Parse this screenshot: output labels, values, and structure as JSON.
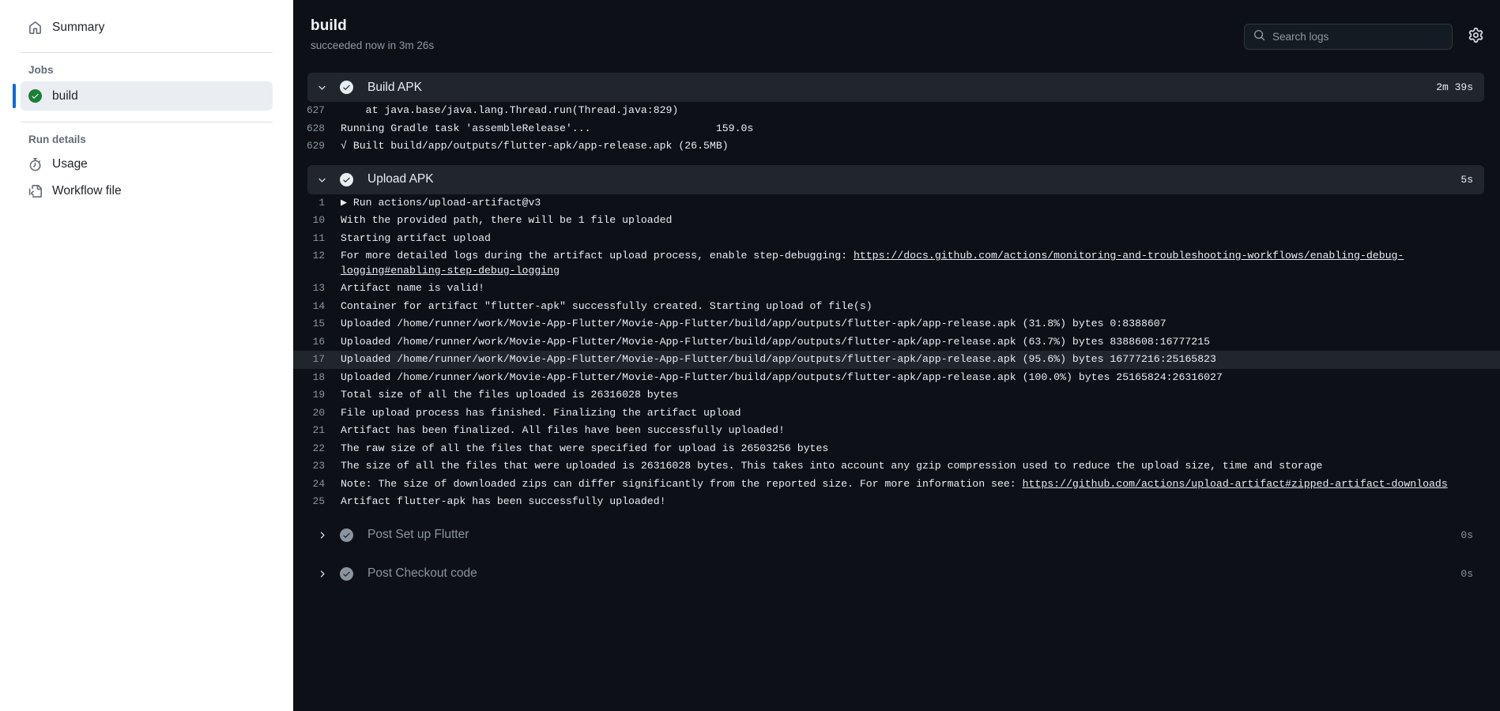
{
  "sidebar": {
    "summary": {
      "label": "Summary",
      "icon": "home-icon"
    },
    "jobs_group_label": "Jobs",
    "job": {
      "label": "build",
      "status": "success"
    },
    "run_details_group_label": "Run details",
    "usage": {
      "label": "Usage",
      "icon": "stopwatch-icon"
    },
    "workflow_file": {
      "label": "Workflow file",
      "icon": "file-code-icon"
    }
  },
  "header": {
    "title": "build",
    "subtitle": "succeeded now in 3m 26s",
    "search_placeholder": "Search logs",
    "search_value": "",
    "gear_label": "gear-icon"
  },
  "colors": {
    "accent_blue": "#0969da",
    "success_green": "#1a7f37",
    "panel_bg": "#0d1117",
    "step_bg": "#21262d",
    "text": "#e6edf3",
    "muted": "#8b949e"
  },
  "steps": [
    {
      "name": "Build APK",
      "duration": "2m 39s",
      "expanded": true,
      "status": "success",
      "lines": [
        {
          "no": "627",
          "text": "    at java.base/java.lang.Thread.run(Thread.java:829)"
        },
        {
          "no": "628",
          "text": "Running Gradle task 'assembleRelease'...                    159.0s"
        },
        {
          "no": "629",
          "text": "√ Built build/app/outputs/flutter-apk/app-release.apk (26.5MB)"
        }
      ]
    },
    {
      "name": "Upload APK",
      "duration": "5s",
      "expanded": true,
      "status": "success",
      "lines": [
        {
          "no": "1",
          "text": "▶ Run actions/upload-artifact@v3"
        },
        {
          "no": "10",
          "text": "With the provided path, there will be 1 file uploaded"
        },
        {
          "no": "11",
          "text": "Starting artifact upload"
        },
        {
          "no": "12",
          "text": "For more detailed logs during the artifact upload process, enable step-debugging: ",
          "link": "https://docs.github.com/actions/monitoring-and-troubleshooting-workflows/enabling-debug-logging#enabling-step-debug-logging"
        },
        {
          "no": "13",
          "text": "Artifact name is valid!"
        },
        {
          "no": "14",
          "text": "Container for artifact \"flutter-apk\" successfully created. Starting upload of file(s)"
        },
        {
          "no": "15",
          "text": "Uploaded /home/runner/work/Movie-App-Flutter/Movie-App-Flutter/build/app/outputs/flutter-apk/app-release.apk (31.8%) bytes 0:8388607"
        },
        {
          "no": "16",
          "text": "Uploaded /home/runner/work/Movie-App-Flutter/Movie-App-Flutter/build/app/outputs/flutter-apk/app-release.apk (63.7%) bytes 8388608:16777215"
        },
        {
          "no": "17",
          "text": "Uploaded /home/runner/work/Movie-App-Flutter/Movie-App-Flutter/build/app/outputs/flutter-apk/app-release.apk (95.6%) bytes 16777216:25165823",
          "highlighted": true
        },
        {
          "no": "18",
          "text": "Uploaded /home/runner/work/Movie-App-Flutter/Movie-App-Flutter/build/app/outputs/flutter-apk/app-release.apk (100.0%) bytes 25165824:26316027"
        },
        {
          "no": "19",
          "text": "Total size of all the files uploaded is 26316028 bytes"
        },
        {
          "no": "20",
          "text": "File upload process has finished. Finalizing the artifact upload"
        },
        {
          "no": "21",
          "text": "Artifact has been finalized. All files have been successfully uploaded!"
        },
        {
          "no": "22",
          "text": "The raw size of all the files that were specified for upload is 26503256 bytes"
        },
        {
          "no": "23",
          "text": "The size of all the files that were uploaded is 26316028 bytes. This takes into account any gzip compression used to reduce the upload size, time and storage"
        },
        {
          "no": "24",
          "text": "Note: The size of downloaded zips can differ significantly from the reported size. For more information see: ",
          "link": "https://github.com/actions/upload-artifact#zipped-artifact-downloads"
        },
        {
          "no": "25",
          "text": "Artifact flutter-apk has been successfully uploaded!"
        }
      ]
    },
    {
      "name": "Post Set up Flutter",
      "duration": "0s",
      "expanded": false,
      "status": "success",
      "lines": []
    },
    {
      "name": "Post Checkout code",
      "duration": "0s",
      "expanded": false,
      "status": "success",
      "lines": []
    }
  ]
}
